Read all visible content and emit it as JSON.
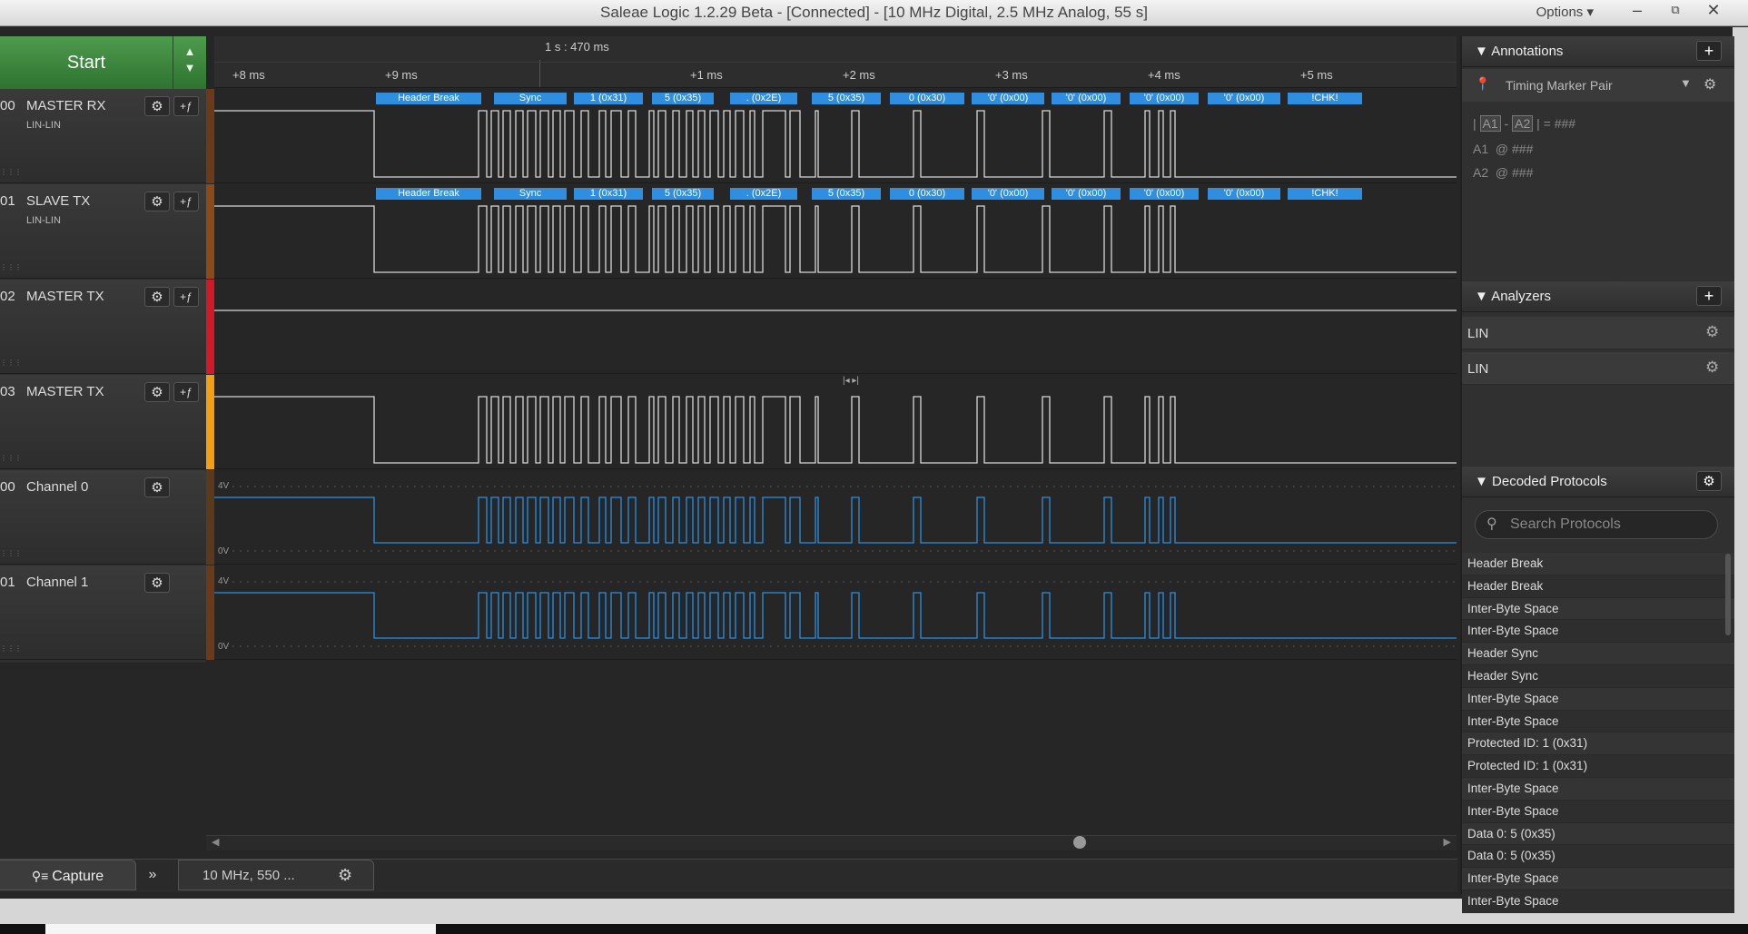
{
  "window": {
    "title": "Saleae Logic 1.2.29 Beta - [Connected] - [10 MHz Digital, 2.5 MHz Analog, 55 s]",
    "options_label": "Options ▾",
    "minimize": "–",
    "restore": "⧉",
    "close": "✕"
  },
  "start": {
    "label": "Start"
  },
  "timeline": {
    "marker": "1 s : 470 ms",
    "ticks": [
      "+8 ms",
      "+9 ms",
      "+1 ms",
      "+2 ms",
      "+3 ms",
      "+4 ms",
      "+5 ms"
    ]
  },
  "channels": [
    {
      "num": "00",
      "name": "MASTER RX",
      "sub": "LIN-LIN",
      "color": "#6b3a1a"
    },
    {
      "num": "01",
      "name": "SLAVE TX",
      "sub": "LIN-LIN",
      "color": "#8a4a1a"
    },
    {
      "num": "02",
      "name": "MASTER TX",
      "sub": "",
      "color": "#d01a2a"
    },
    {
      "num": "03",
      "name": "MASTER TX",
      "sub": "",
      "color": "#f0a010"
    },
    {
      "num": "00",
      "name": "Channel 0",
      "sub": "",
      "color": "#5a3a1a"
    },
    {
      "num": "01",
      "name": "Channel 1",
      "sub": "",
      "color": "#6b3a1a"
    }
  ],
  "protocol_labels": [
    "Header Break",
    "Sync",
    "1 (0x31)",
    "5 (0x35)",
    ". (0x2E)",
    "5 (0x35)",
    "0 (0x30)",
    "'0' (0x00)",
    "'0' (0x00)",
    "'0' (0x00)",
    "'0' (0x00)",
    "!CHK!"
  ],
  "analog": {
    "top": "4V",
    "bottom": "0V"
  },
  "bottom": {
    "capture_tab": "Capture",
    "tab_arrow": "»",
    "rate_tab": "10 MHz, 550 ..."
  },
  "annotations": {
    "title": "Annotations",
    "marker_pair": "Timing Marker Pair",
    "diff_a1": "A1",
    "diff_a2": "A2",
    "diff_eq": "= ###",
    "a1_label": "A1",
    "a1_value": "@ ###",
    "a2_label": "A2",
    "a2_value": "@ ###"
  },
  "analyzers": {
    "title": "Analyzers",
    "items": [
      "LIN",
      "LIN"
    ]
  },
  "decoded": {
    "title": "Decoded Protocols",
    "search_placeholder": "Search Protocols",
    "items": [
      "Header Break",
      "Header Break",
      "Inter-Byte Space",
      "Inter-Byte Space",
      "Header Sync",
      "Header Sync",
      "Inter-Byte Space",
      "Inter-Byte Space",
      "Protected ID: 1 (0x31)",
      "Protected ID: 1 (0x31)",
      "Inter-Byte Space",
      "Inter-Byte Space",
      "Data 0: 5 (0x35)",
      "Data 0: 5 (0x35)",
      "Inter-Byte Space",
      "Inter-Byte Space"
    ]
  }
}
